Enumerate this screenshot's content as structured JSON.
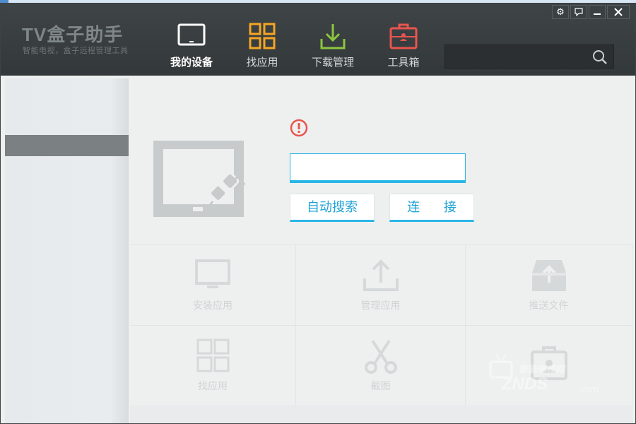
{
  "app": {
    "logo": "TV盒子助手",
    "subtitle": "智能电视，盒子远程管理工具"
  },
  "nav": [
    {
      "label": "我的设备",
      "icon": "tv-icon",
      "active": true
    },
    {
      "label": "找应用",
      "icon": "grid-apps-icon",
      "active": false
    },
    {
      "label": "下载管理",
      "icon": "download-icon",
      "active": false
    },
    {
      "label": "工具箱",
      "icon": "toolbox-icon",
      "active": false
    }
  ],
  "search": {
    "value": "",
    "placeholder": ""
  },
  "window_controls": [
    "gear-icon",
    "feedback-icon",
    "minimize-icon",
    "close-icon"
  ],
  "connect": {
    "ip_value": "",
    "auto_search_label": "自动搜索",
    "connect_label": "连 接"
  },
  "tiles": [
    {
      "label": "安装应用",
      "icon": "monitor-icon"
    },
    {
      "label": "管理应用",
      "icon": "upload-icon"
    },
    {
      "label": "推送文件",
      "icon": "inbox-upload-icon"
    },
    {
      "label": "找应用",
      "icon": "grid-apps-icon"
    },
    {
      "label": "截图",
      "icon": "scissors-icon"
    },
    {
      "label": "",
      "icon": "user-card-icon"
    }
  ],
  "watermark": {
    "line1": "智能电视网",
    "line2": "ZNDS",
    "line3": ".com"
  },
  "colors": {
    "accent": "#29b6e6",
    "titlebar": "#3a3f41",
    "warning": "#e8554e",
    "download_green": "#8cc63f",
    "toolbox_red": "#e8554e",
    "apps_orange": "#f5a623"
  }
}
